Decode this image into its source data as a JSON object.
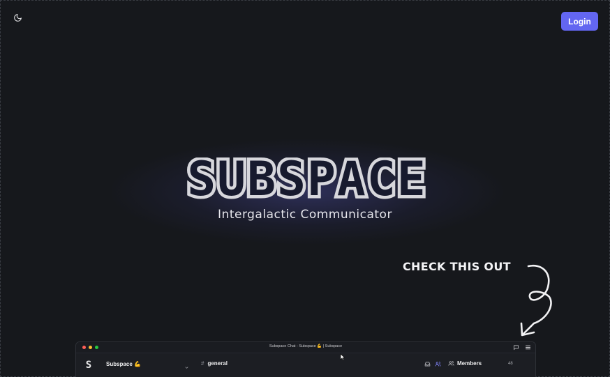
{
  "header": {
    "theme_toggle_icon": "moon-icon",
    "login_label": "Login",
    "accent_color": "#6366f1"
  },
  "hero": {
    "logo_text": "SUBSPACE",
    "tagline": "Intergalactic Communicator"
  },
  "callout": {
    "text": "CHECK THIS OUT",
    "arrow_icon": "curly-arrow-icon"
  },
  "app_preview": {
    "window_title": "Subspace Chat - Subspace 💪 | Subspace",
    "server_logo": "S",
    "server_name": "Subspace 💪",
    "channel_name": "general",
    "members_label": "Members",
    "members_count": "48",
    "icons": [
      "inbox-icon",
      "users-icon",
      "chat-bubble-icon",
      "menu-icon",
      "chevron-down-icon",
      "hash-icon"
    ]
  }
}
